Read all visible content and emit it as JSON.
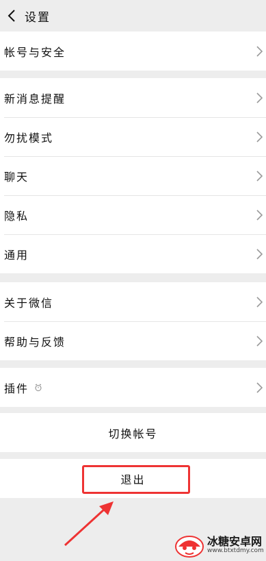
{
  "header": {
    "title": "设置"
  },
  "groups": {
    "account": "帐号与安全",
    "new_message": "新消息提醒",
    "dnd": "勿扰模式",
    "chat": "聊天",
    "privacy": "隐私",
    "general": "通用",
    "about": "关于微信",
    "help": "帮助与反馈",
    "plugins": "插件"
  },
  "buttons": {
    "switch_account": "切换帐号",
    "logout": "退出"
  },
  "watermark": {
    "name": "冰糖安卓网",
    "url": "www.btxtdmy.com"
  },
  "colors": {
    "highlight": "#e33",
    "arrow": "#e33",
    "background": "#ededed"
  }
}
